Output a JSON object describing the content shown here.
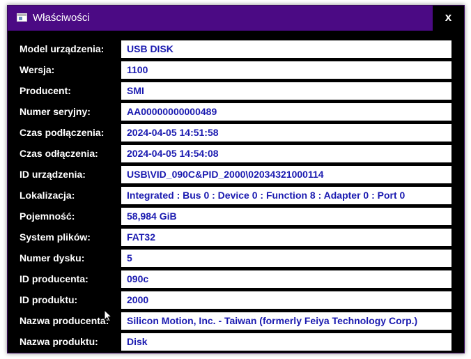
{
  "window": {
    "title": "Właściwości",
    "close_label": "x"
  },
  "properties": [
    {
      "label": "Model urządzenia:",
      "value": "USB DISK"
    },
    {
      "label": "Wersja:",
      "value": "1100"
    },
    {
      "label": "Producent:",
      "value": "SMI"
    },
    {
      "label": "Numer seryjny:",
      "value": "AA00000000000489"
    },
    {
      "label": "Czas podłączenia:",
      "value": "2024-04-05 14:51:58"
    },
    {
      "label": "Czas odłączenia:",
      "value": "2024-04-05 14:54:08"
    },
    {
      "label": "ID urządzenia:",
      "value": "USB\\VID_090C&PID_2000\\02034321000114"
    },
    {
      "label": "Lokalizacja:",
      "value": "Integrated : Bus 0 : Device 0 : Function 8 : Adapter 0 : Port 0"
    },
    {
      "label": "Pojemność:",
      "value": "58,984 GiB"
    },
    {
      "label": "System plików:",
      "value": "FAT32"
    },
    {
      "label": "Numer dysku:",
      "value": "5"
    },
    {
      "label": "ID producenta:",
      "value": "090c"
    },
    {
      "label": "ID produktu:",
      "value": "2000"
    },
    {
      "label": "Nazwa producenta:",
      "value": "Silicon Motion, Inc. - Taiwan (formerly Feiya Technology Corp.)"
    },
    {
      "label": "Nazwa produktu:",
      "value": "Disk"
    }
  ],
  "colors": {
    "titlebar": "#4b0a84",
    "background": "#000000",
    "value_text": "#1a1ab0"
  }
}
